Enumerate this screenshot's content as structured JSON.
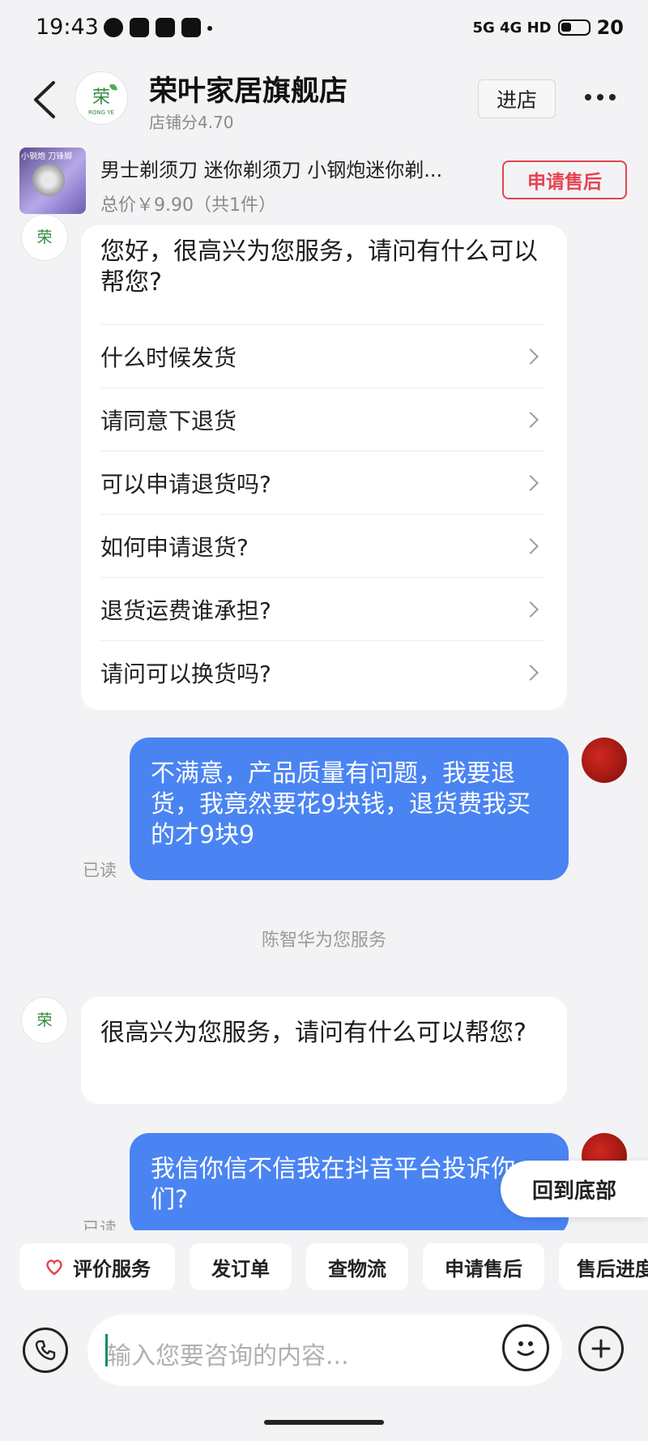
{
  "status_bar": {
    "time": "19:43",
    "network": "5G 4G HD",
    "battery": "20"
  },
  "header": {
    "shop_name": "荣叶家居旗舰店",
    "shop_score": "店铺分4.70",
    "enter_label": "进店"
  },
  "order": {
    "thumb_text": "小钢炮 刀锋脚",
    "title": "男士剃须刀 迷你剃须刀 小钢炮迷你剃...",
    "price": "总价￥9.90（共1件）",
    "aftersale_label": "申请售后"
  },
  "greeting": {
    "text": "您好，很高兴为您服务，请问有什么可以帮您?",
    "questions": [
      "什么时候发货",
      "请同意下退货",
      "可以申请退货吗?",
      "如何申请退货?",
      "退货运费谁承担?",
      "请问可以换货吗?"
    ]
  },
  "messages": {
    "user_msg1": "不满意，产品质量有问题，我要退货，我竟然要花9块钱，退货费我买的才9块9",
    "read1": "已读",
    "system_notice": "陈智华为您服务",
    "shop_msg2": "很高兴为您服务，请问有什么可以帮您?",
    "user_msg2": "我信你信不信我在抖音平台投诉你们?",
    "read2": "已读"
  },
  "scroll_to_bottom": "回到底部",
  "quick_actions": [
    "评价服务",
    "发订单",
    "查物流",
    "申请售后",
    "售后进度"
  ],
  "input": {
    "placeholder": "输入您要咨询的内容..."
  },
  "colors": {
    "user_bubble": "#4a84f2",
    "accent_red": "#e5434f",
    "logo_green": "#2e8b3e"
  }
}
